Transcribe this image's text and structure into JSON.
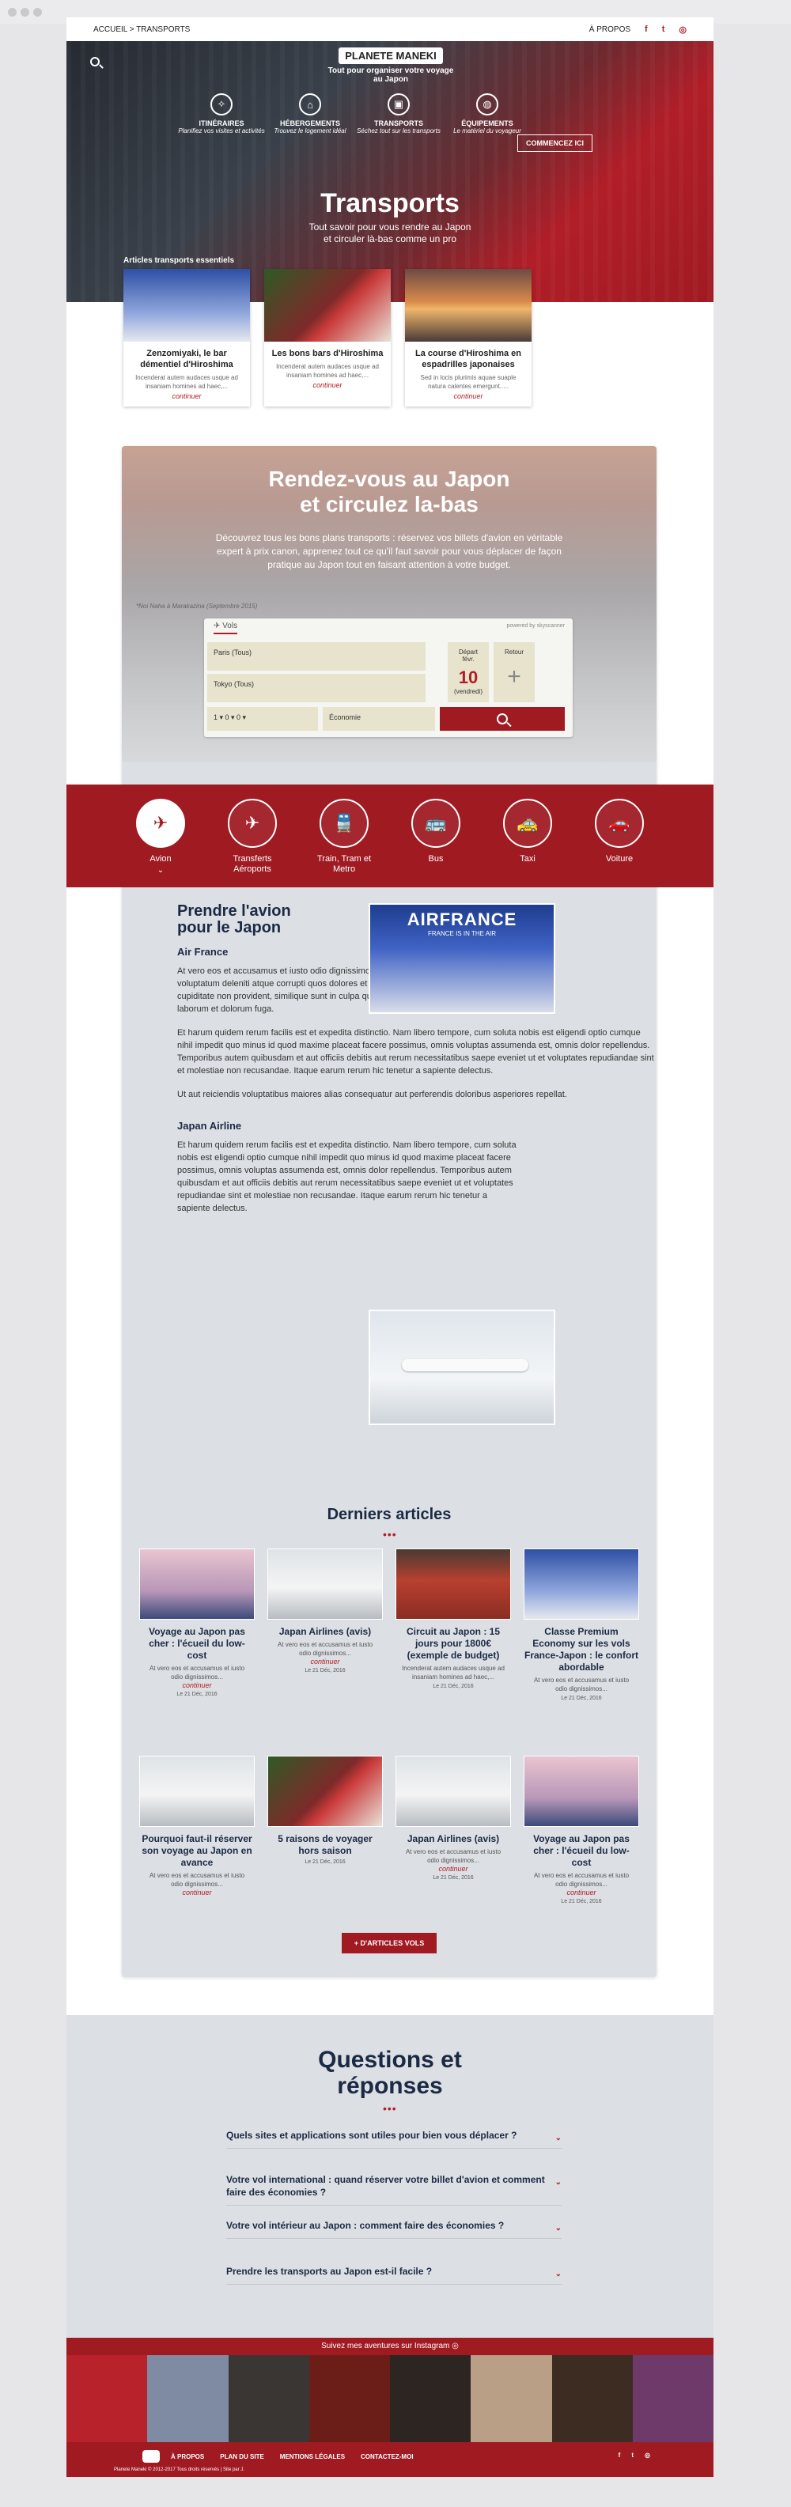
{
  "topbar": {
    "breadcrumb": "ACCUEIL > TRANSPORTS",
    "about": "À PROPOS"
  },
  "header": {
    "logo": "PLANETE MANEKI",
    "tagline": "Tout pour organiser votre voyage au Japon",
    "nav": [
      {
        "label": "ITINÉRAIRES",
        "sub": "Planifiez vos visites et activités"
      },
      {
        "label": "HÉBERGEMENTS",
        "sub": "Trouvez le logement idéal"
      },
      {
        "label": "TRANSPORTS",
        "sub": "Séchez tout sur les transports"
      },
      {
        "label": "ÉQUIPEMENTS",
        "sub": "Le matériel du voyageur"
      }
    ],
    "cta": "COMMENCEZ ICI",
    "title": "Transports",
    "subtitle_1": "Tout savoir pour vous rendre au Japon",
    "subtitle_2": "et circuler là-bas comme un pro",
    "essentials": "Articles transports essentiels"
  },
  "featured": [
    {
      "title": "Zenzomiyaki, le bar démentiel d'Hiroshima",
      "excerpt": "Incenderat autem audaces usque ad insaniam homines ad haec,...",
      "more": "continuer"
    },
    {
      "title": "Les bons bars d'Hiroshima",
      "excerpt": "Incenderat autem audaces usque ad insaniam homines ad haec,...",
      "more": "continuer"
    },
    {
      "title": "La course d'Hiroshima en espadrilles japonaises",
      "excerpt": "Sed in locis plurimis aquae suaple natura calentes emergunt.....",
      "more": "continuer"
    }
  ],
  "rdv": {
    "title_1": "Rendez-vous au Japon",
    "title_2": "et circulez la-bas",
    "text": "Découvrez tous les bons plans transports : réservez vos billets d'avion en véritable expert à prix canon, apprenez tout ce qu'il faut savoir pour vous déplacer de façon pratique au Japon tout en faisant attention à votre budget.",
    "caption": "*Noi Naha à Marakazina (Septembre 2015)"
  },
  "widget": {
    "tab": "Vols",
    "powered": "powered by skyscanner",
    "from": "Paris (Tous)",
    "to": "Tokyo (Tous)",
    "depart_label": "Départ",
    "depart_month": "févr.",
    "depart_day": "10",
    "depart_dow": "(vendredi)",
    "retour_label": "Retour",
    "retour_plus": "+",
    "pax": "1 ▾   0 ▾   0 ▾",
    "class": "Économie"
  },
  "transport_tabs": [
    {
      "label": "Avion",
      "icon": "✈"
    },
    {
      "label": "Transferts Aéroports",
      "icon": "✈"
    },
    {
      "label": "Train, Tram et Metro",
      "icon": "🚆"
    },
    {
      "label": "Bus",
      "icon": "🚌"
    },
    {
      "label": "Taxi",
      "icon": "🚕"
    },
    {
      "label": "Voiture",
      "icon": "🚗"
    }
  ],
  "article": {
    "heading": "Prendre l'avion pour le Japon",
    "af_title": "Air France",
    "af_p1": "At vero eos et accusamus et iusto odio dignissimos ducimus qui blanditiis praesentium voluptatum deleniti atque corrupti quos dolores et quas molestias excepturi sint occaecati cupiditate non provident, similique sunt in culpa qui officia deserunt mollitia animi, id est laborum et dolorum fuga.",
    "af_p2": "Et harum quidem rerum facilis est et expedita distinctio. Nam libero tempore, cum soluta nobis est eligendi optio cumque nihil impedit quo minus id quod maxime placeat facere possimus, omnis voluptas assumenda est, omnis dolor repellendus. Temporibus autem quibusdam et aut officiis debitis aut rerum necessitatibus saepe eveniet ut et voluptates repudiandae sint et molestiae non recusandae. Itaque earum rerum hic tenetur a sapiente delectus.",
    "af_p3": "Ut aut reiciendis voluptatibus maiores alias consequatur aut perferendis doloribus asperiores repellat.",
    "jal_title": "Japan Airline",
    "jal_p1": "Et harum quidem rerum facilis est et expedita distinctio. Nam libero tempore, cum soluta nobis est eligendi optio cumque nihil impedit quo minus id quod maxime placeat facere possimus, omnis voluptas assumenda est, omnis dolor repellendus. Temporibus autem quibusdam et aut officiis debitis aut rerum necessitatibus saepe eveniet ut et voluptates repudiandae sint et molestiae non recusandae. Itaque earum rerum hic tenetur a sapiente delectus.",
    "af_logo": "AIRFRANCE",
    "af_slogan": "FRANCE IS IN THE AIR"
  },
  "latest": {
    "title": "Derniers articles",
    "button": "+ D'ARTICLES VOLS",
    "items": [
      {
        "title": "Voyage au Japon pas cher : l'écueil du low-cost",
        "excerpt": "At vero eos et accusamus et iusto odio dignissimos...",
        "more": "continuer",
        "date": "Le 21 Déc, 2016"
      },
      {
        "title": "Japan Airlines (avis)",
        "excerpt": "At vero eos et accusamus et iusto odio dignissimos...",
        "more": "continuer",
        "date": "Le 21 Déc, 2016"
      },
      {
        "title": "Circuit au Japon : 15 jours pour 1800€ (exemple de budget)",
        "excerpt": "Incenderat autem audaces usque ad insaniam homines ad haec,...",
        "more": "",
        "date": "Le 21 Déc, 2016"
      },
      {
        "title": "Classe Premium Economy sur les vols France-Japon : le confort abordable",
        "excerpt": "At vero eos et accusamus et iusto odio dignissimos...",
        "more": "",
        "date": "Le 21 Déc, 2016"
      },
      {
        "title": "Pourquoi faut-il réserver son voyage au Japon en avance",
        "excerpt": "At vero eos et accusamus et iusto odio dignissimos...",
        "more": "continuer",
        "date": ""
      },
      {
        "title": "5 raisons de voyager hors saison",
        "excerpt": "",
        "more": "",
        "date": "Le 21 Déc, 2016"
      },
      {
        "title": "Japan Airlines (avis)",
        "excerpt": "At vero eos et accusamus et iusto odio dignissimos...",
        "more": "continuer",
        "date": "Le 21 Déc, 2016"
      },
      {
        "title": "Voyage au Japon pas cher : l'écueil du low-cost",
        "excerpt": "At vero eos et accusamus et iusto odio dignissimos...",
        "more": "continuer",
        "date": "Le 21 Déc, 2016"
      }
    ]
  },
  "faq": {
    "title_1": "Questions et",
    "title_2": "réponses",
    "items": [
      "Quels sites et applications sont utiles pour bien vous déplacer ?",
      "Votre vol international : quand réserver votre billet d'avion et comment faire des économies ?",
      "Votre vol intérieur au Japon : comment faire des économies ?",
      "Prendre les transports au Japon est-il facile ?"
    ]
  },
  "instagram": {
    "label": "Suivez mes aventures sur Instagram"
  },
  "footer": {
    "links": [
      "À PROPOS",
      "PLAN DU SITE",
      "MENTIONS LÉGALES",
      "CONTACTEZ-MOI"
    ],
    "copy": "Planete Maneki © 2012-2017 Tous droits réservés | Site par J."
  },
  "colors": {
    "brand": "#a01a22",
    "navy": "#1b2a44"
  }
}
